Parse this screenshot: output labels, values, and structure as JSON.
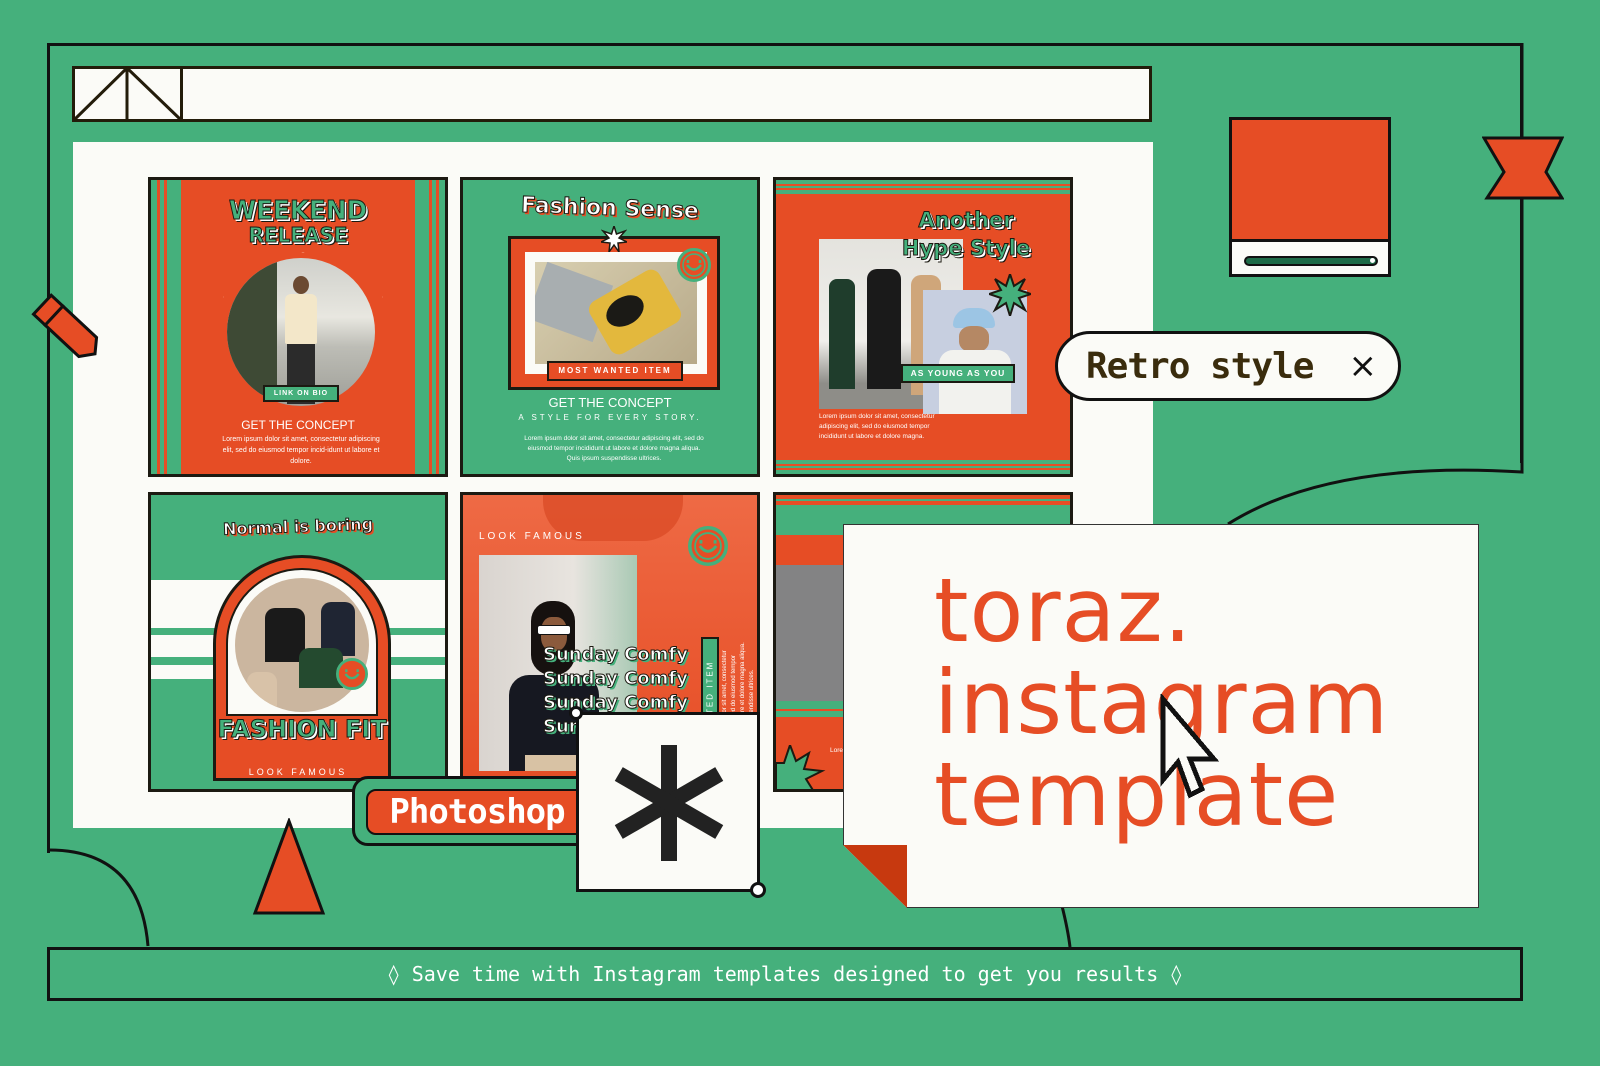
{
  "colors": {
    "background": "#45b07c",
    "accent_orange": "#e64d25",
    "ink": "#1c1a12",
    "paper": "#fbfbf7"
  },
  "posts": [
    {
      "headline_line1": "WEEKEND",
      "headline_line2": "RELEASE",
      "button": "LINK ON BIO",
      "subtitle": "GET THE CONCEPT",
      "body": "Lorem ipsum dolor sit amet, consectetur adipiscing elit, sed do eiusmod tempor incid-idunt ut labore et dolore."
    },
    {
      "headline": "Fashion Sense",
      "tag": "MOST WANTED ITEM",
      "subtitle": "GET THE CONCEPT",
      "tagline": "A STYLE FOR EVERY STORY.",
      "body": "Lorem ipsum dolor sit amet, consectetur adipiscing elit, sed do eiusmod tempor incididunt ut labore et dolore magna aliqua. Quis ipsum suspendisse ultrices."
    },
    {
      "headline_line1": "Another",
      "headline_line2": "Hype Style",
      "tag": "AS YOUNG AS YOU",
      "body": "Lorem ipsum dolor sit amet, consectetur adipiscing elit, sed do eiusmod tempor incididunt ut labore et dolore magna."
    },
    {
      "headline": "Normal is boring",
      "title": "FASHION FIT",
      "footer": "LOOK FAMOUS"
    },
    {
      "kicker": "LOOK FAMOUS",
      "repeat_text": [
        "Sunday Comfy",
        "Sunday Comfy",
        "Sunday Comfy",
        "Sunday Comfy"
      ],
      "vertical_tag": "WANTED ITEM",
      "vertical_body": "Lorem ipsum dolor sit amet, consectetur adipiscing elit, sed do eiusmod tempor incididunt ut labore et dolore magna aliqua. Quis ipsum suspendisse ultrices."
    },
    {
      "body_fragment": "Lorem ipsum dolor sit amet"
    }
  ],
  "chips": {
    "retro_style": "Retro style",
    "retro_close": "×",
    "photoshop": "Photoshop"
  },
  "title_card": {
    "line1": "toraz.",
    "line2": "instagram",
    "line3": "template"
  },
  "footer": {
    "text": "◊ Save time with Instagram templates designed to get you results ◊"
  },
  "slider": {
    "value_fraction": 1.0
  }
}
